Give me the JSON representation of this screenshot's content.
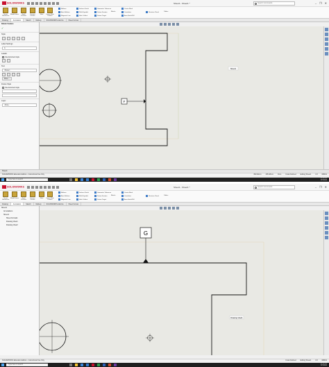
{
  "app": {
    "brand": "SOLIDWORKS",
    "document_title": "Sheet1 - Sheet1 *",
    "search_placeholder": "Search Commands",
    "window_controls": [
      "–",
      "❐",
      "✕"
    ]
  },
  "command_manager": {
    "big_buttons": [
      "Smart Dimension",
      "Model Items",
      "Spell Checker",
      "Format Painter",
      "Note",
      "Linear Note Pattern"
    ],
    "small_buttons": [
      "Balloon",
      "Auto Balloon",
      "Magnetic Line",
      "Surface Finish",
      "Weld Symbol",
      "Hole Callout",
      "Geometric Tolerance",
      "Datum Feature",
      "Datum Target",
      "Center Mark",
      "Centerline",
      "Area Hatch/Fill",
      "Blocks",
      "Revision Cloud",
      "Tables"
    ]
  },
  "tabs": [
    "Drawing",
    "Annotation",
    "Sketch",
    "Markup",
    "SOLIDWORKS Add-Ins",
    "Sheet Format"
  ],
  "active_tab": "Annotation",
  "top": {
    "panel_title": "Datum Feature",
    "panel_sections": {
      "style": "Style",
      "label_settings": "Label Settings",
      "label_value": "A",
      "leader": "Leader",
      "leader_option": "Use document style",
      "text": "Text",
      "text_value": "<None>",
      "more_button": "More...",
      "frame_style": "Frame Style",
      "frame_option": "Use document style",
      "layer": "Layer",
      "layer_value": "-None-"
    },
    "datum_label": "F",
    "note_label": "Sheet1",
    "status": {
      "left": "SOLIDWORKS Education Edition - Instructional Use Only",
      "coords": [
        "390.62mm",
        "305.48mm",
        "0mm"
      ],
      "state": "Under Defined",
      "mode": "Editing Sheet1",
      "scale": "1:8",
      "units": "MMGS"
    }
  },
  "bottom": {
    "tree": [
      "Sheet1",
      "Annotations",
      "Sheet1",
      "Sheet Format1",
      "Drawing View1",
      "Drawing View2"
    ],
    "datum_label": "G",
    "note_label": "Drawing View1",
    "status": {
      "left": "SOLIDWORKS Education Edition - Instructional Use Only",
      "state": "Under Defined",
      "mode": "Editing Sheet1",
      "scale": "1:8",
      "units": "MMGS"
    }
  },
  "sheet_tabs": [
    "Sheet1"
  ],
  "taskbar": {
    "search_placeholder": "Type here to search",
    "time": "11:10 AM",
    "date": "8/7/2022"
  },
  "colors": {
    "canvas": "#e9e9e4",
    "brand_red": "#c8102e",
    "taskbar": "#1f1f1f",
    "sheet_border": "#e8d8b8"
  }
}
